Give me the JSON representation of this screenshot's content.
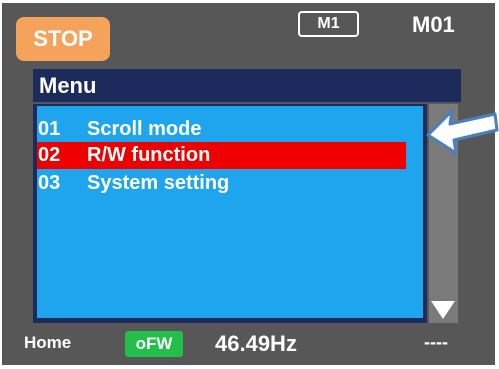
{
  "header": {
    "stop_label": "STOP",
    "mode_label": "M1",
    "monitor_code": "M01"
  },
  "menu": {
    "title": "Menu",
    "items": [
      {
        "num": "01",
        "label": "Scroll mode",
        "selected": false
      },
      {
        "num": "02",
        "label": "R/W function",
        "selected": true
      },
      {
        "num": "03",
        "label": "System setting",
        "selected": false
      }
    ]
  },
  "status": {
    "home": "Home",
    "direction_badge": "oFW",
    "frequency": "46.49Hz",
    "extra": "----"
  },
  "colors": {
    "screen_bg": "#575757",
    "stop_button": "#f5a35a",
    "menu_header": "#1c2a5c",
    "menu_list": "#1fa4ee",
    "selection": "#ee0000",
    "fw_badge": "#22c04a",
    "arrow_outline": "#4a7fc0"
  },
  "icons": {
    "scroll_down": "triangle-down-icon",
    "pointer": "left-arrow-icon"
  }
}
